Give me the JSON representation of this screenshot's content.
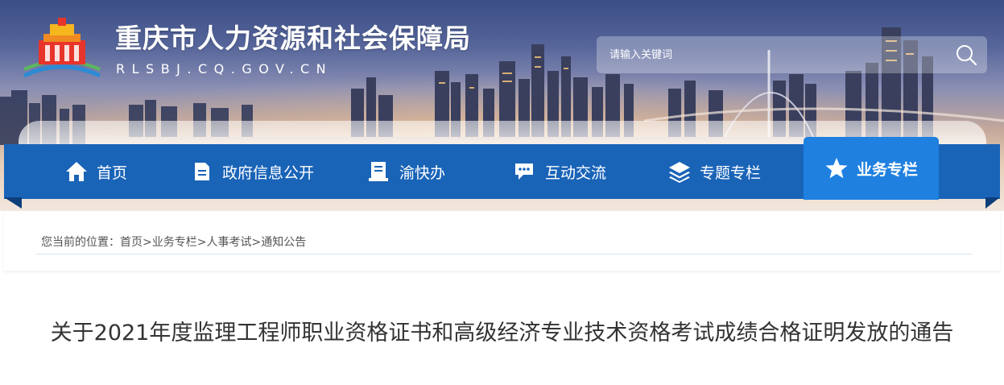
{
  "header": {
    "title": "重庆市人力资源和社会保障局",
    "domain": "RLSBJ.CQ.GOV.CN",
    "logo_icon": "gov-building-logo-icon"
  },
  "search": {
    "placeholder": "请输入关键词",
    "icon": "search-icon"
  },
  "nav": {
    "items": [
      {
        "label": "首页",
        "icon": "home-icon"
      },
      {
        "label": "政府信息公开",
        "icon": "document-icon"
      },
      {
        "label": "渝快办",
        "icon": "service-icon"
      },
      {
        "label": "互动交流",
        "icon": "chat-icon"
      },
      {
        "label": "专题专栏",
        "icon": "layers-icon"
      },
      {
        "label": "业务专栏",
        "icon": "star-icon",
        "active": true
      }
    ],
    "colors": {
      "bar": "#1a64b8",
      "active": "#1f80e0"
    }
  },
  "breadcrumb": {
    "prefix": "您当前的位置：",
    "items": [
      "首页",
      "业务专栏",
      "人事考试",
      "通知公告"
    ],
    "separator": ">"
  },
  "article": {
    "title": "关于2021年度监理工程师职业资格证书和高级经济专业技术资格考试成绩合格证明发放的通告"
  }
}
